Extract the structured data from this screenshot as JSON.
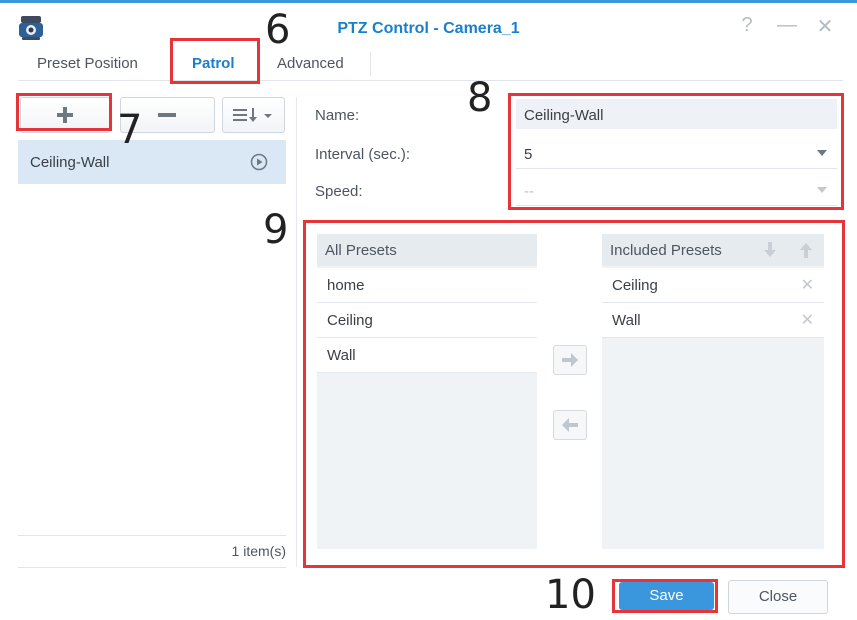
{
  "window": {
    "title": "PTZ Control - Camera_1",
    "help_label": "?",
    "minimize_label": "—",
    "close_label": "✕"
  },
  "tabs": [
    {
      "label": "Preset Position",
      "active": false
    },
    {
      "label": "Patrol",
      "active": true
    },
    {
      "label": "Advanced",
      "active": false
    }
  ],
  "toolbar": {
    "add_icon": "plus-icon",
    "remove_icon": "minus-icon",
    "sort_icon": "sort-icon"
  },
  "patrol_list": {
    "items": [
      {
        "label": "Ceiling-Wall",
        "icon": "play-circle-icon"
      }
    ],
    "count_text": "1 item(s)"
  },
  "form": {
    "name_label": "Name:",
    "name_value": "Ceiling-Wall",
    "interval_label": "Interval (sec.):",
    "interval_value": "5",
    "speed_label": "Speed:",
    "speed_value": "--"
  },
  "presets": {
    "all_header": "All Presets",
    "all_items": [
      "home",
      "Ceiling",
      "Wall"
    ],
    "included_header": "Included Presets",
    "included_items": [
      "Ceiling",
      "Wall"
    ]
  },
  "footer": {
    "save_label": "Save",
    "close_label": "Close"
  },
  "callouts": [
    "6",
    "7",
    "8",
    "9",
    "10"
  ],
  "colors": {
    "accent": "#1b7fcc",
    "primary_button": "#3a96dd",
    "selection": "#dae8f5",
    "callout_border": "#e5343a"
  }
}
